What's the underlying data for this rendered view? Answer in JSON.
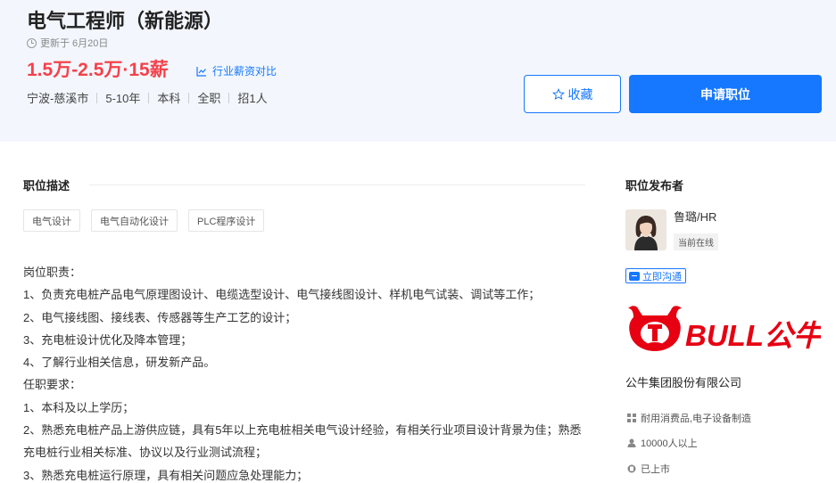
{
  "job": {
    "title": "电气工程师（新能源）",
    "updated": "更新于 6月20日",
    "salary": "1.5万-2.5万·15薪",
    "salary_compare": "行业薪资对比",
    "meta": [
      "宁波-慈溪市",
      "5-10年",
      "本科",
      "全职",
      "招1人"
    ]
  },
  "actions": {
    "favorite": "收藏",
    "apply": "申请职位"
  },
  "description": {
    "section_title": "职位描述",
    "tags": [
      "电气设计",
      "电气自动化设计",
      "PLC程序设计"
    ],
    "lines": [
      "岗位职责：",
      "1、负责充电桩产品电气原理图设计、电缆选型设计、电气接线图设计、样机电气试装、调试等工作；",
      "2、电气接线图、接线表、传感器等生产工艺的设计；",
      "3、充电桩设计优化及降本管理；",
      "4、了解行业相关信息，研发新产品。",
      "任职要求：",
      "1、本科及以上学历；",
      "2、熟悉充电桩产品上游供应链，具有5年以上充电桩相关电气设计经验，有相关行业项目设计背景为佳；熟悉充电桩行业相关标准、协议以及行业测试流程；",
      "3、熟悉充电桩运行原理，具有相关问题应急处理能力；"
    ]
  },
  "publisher": {
    "section_title": "职位发布者",
    "name": "鲁璐/HR",
    "status": "当前在线",
    "chat": "立即沟通"
  },
  "company": {
    "logo_text": "BULL公牛",
    "name": "公牛集团股份有限公司",
    "industry": "耐用消费品,电子设备制造",
    "size": "10000人以上",
    "stage": "已上市"
  },
  "colors": {
    "accent": "#1677ff",
    "salary": "#f5414b",
    "logo_red": "#e60012"
  }
}
